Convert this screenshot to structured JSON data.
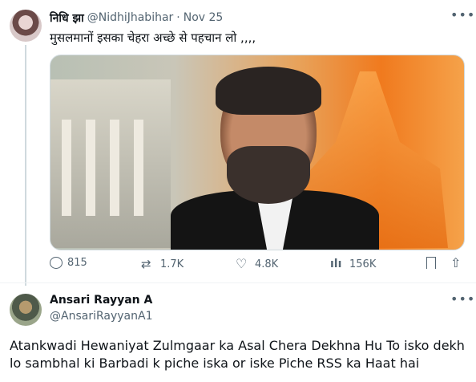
{
  "tweet": {
    "display_name": "निधि झा",
    "handle": "@NidhiJhabihar",
    "separator": "·",
    "timestamp": "Nov 25",
    "text": "मुसलमानों इसका चेहरा अच्छे से पहचान लो ,,,,",
    "media_icon": "photo-image",
    "stats": {
      "replies": "815",
      "retweets": "1.7K",
      "likes": "4.8K",
      "views": "156K"
    },
    "icons": [
      "reply-icon",
      "retweet-icon",
      "like-icon",
      "views-icon",
      "bookmark-icon",
      "share-icon",
      "more-icon"
    ]
  },
  "reply": {
    "display_name": "Ansari Rayyan A",
    "handle": "@AnsariRayyanA1",
    "text": "Atankwadi Hewaniyat Zulmgaar ka Asal Chera Dekhna Hu To isko dekh lo sambhal ki Barbadi k piche iska or iske Piche RSS ka Haat hai"
  },
  "colors": {
    "text_primary": "#0f1419",
    "text_secondary": "#536471",
    "border": "#cfd9de",
    "background": "#ffffff"
  }
}
